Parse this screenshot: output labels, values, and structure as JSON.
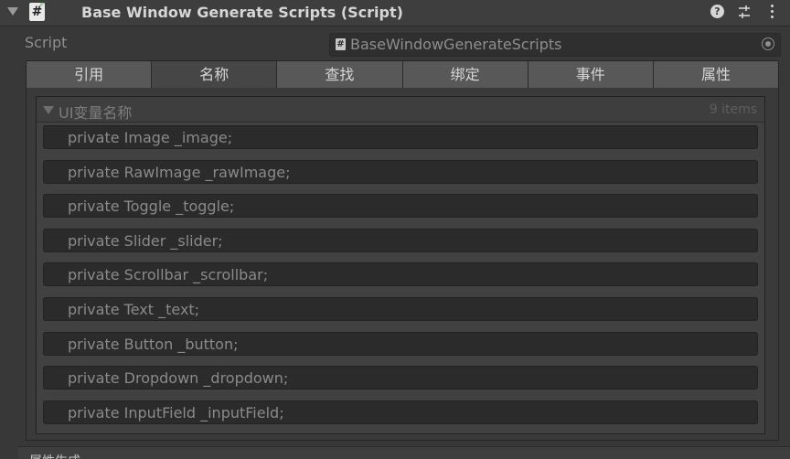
{
  "header": {
    "title": "Base Window Generate Scripts (Script)",
    "help_glyph": "?",
    "script_glyph": "#"
  },
  "script": {
    "label": "Script",
    "value": "BaseWindowGenerateScripts"
  },
  "tabs": [
    {
      "label": "引用",
      "active": false
    },
    {
      "label": "名称",
      "active": true
    },
    {
      "label": "查找",
      "active": false
    },
    {
      "label": "绑定",
      "active": false
    },
    {
      "label": "事件",
      "active": false
    },
    {
      "label": "属性",
      "active": false
    }
  ],
  "list": {
    "title": "UI变量名称",
    "count": "9 items",
    "items": [
      "private Image _image;",
      "private RawImage _rawImage;",
      "private Toggle _toggle;",
      "private Slider _slider;",
      "private Scrollbar _scrollbar;",
      "private Text _text;",
      "private Button _button;",
      "private Dropdown _dropdown;",
      "private InputField _inputField;"
    ]
  },
  "bottom": {
    "label": "属性生成"
  },
  "icons": [
    "foldout-arrow-icon",
    "script-icon",
    "help-icon",
    "preset-icon",
    "kebab-menu-icon",
    "object-picker-icon"
  ]
}
